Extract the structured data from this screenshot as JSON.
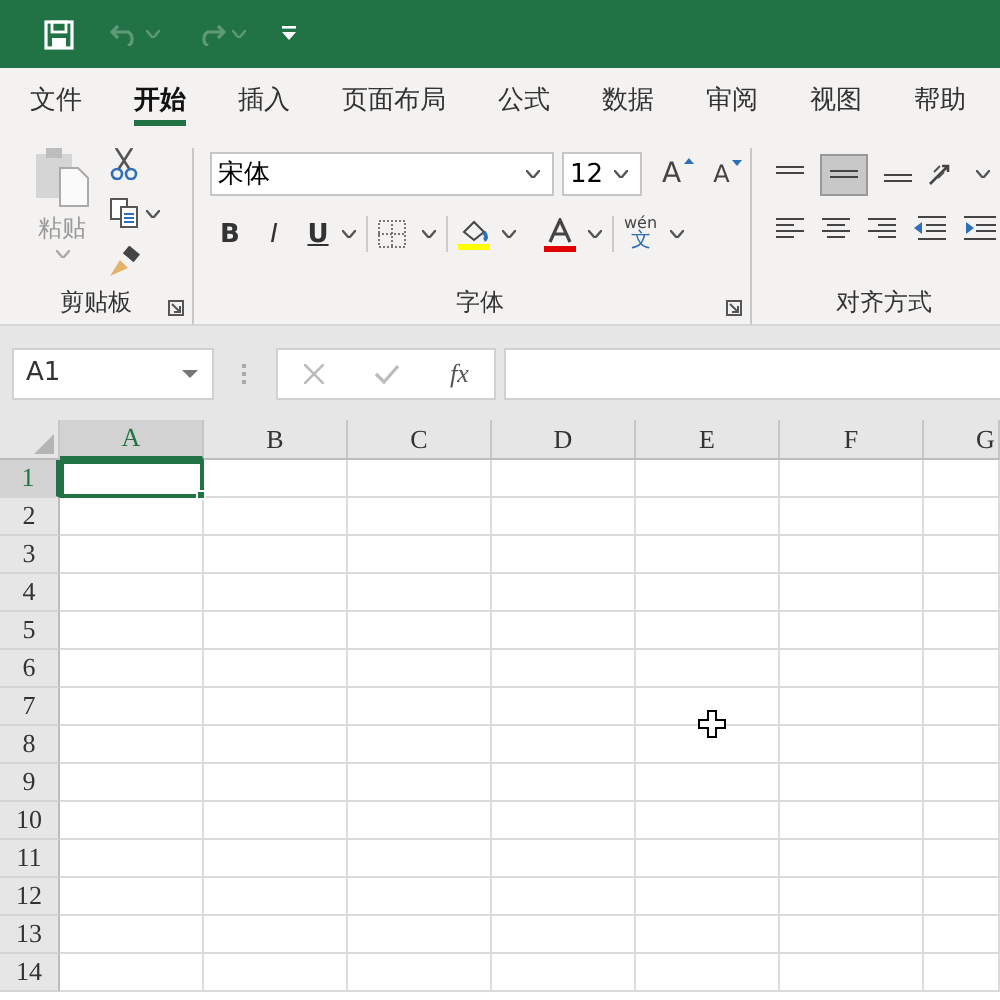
{
  "tabs": [
    {
      "label": "文件",
      "selected": false
    },
    {
      "label": "开始",
      "selected": true
    },
    {
      "label": "插入",
      "selected": false
    },
    {
      "label": "页面布局",
      "selected": false
    },
    {
      "label": "公式",
      "selected": false
    },
    {
      "label": "数据",
      "selected": false
    },
    {
      "label": "审阅",
      "selected": false
    },
    {
      "label": "视图",
      "selected": false
    },
    {
      "label": "帮助",
      "selected": false
    }
  ],
  "ribbon": {
    "clipboard": {
      "label": "剪贴板",
      "paste_label": "粘贴"
    },
    "font": {
      "label": "字体",
      "font_name": "宋体",
      "font_size": "12",
      "grow_glyph": "A",
      "shrink_glyph": "A",
      "format_buttons": [
        {
          "kind": "bold",
          "label": "B"
        },
        {
          "kind": "italic",
          "label": "I"
        },
        {
          "kind": "underline",
          "label": "U"
        }
      ],
      "phonetic": {
        "pinyin": "wén",
        "char": "文"
      }
    },
    "alignment": {
      "label": "对齐方式"
    }
  },
  "formula_bar": {
    "name_box": "A1",
    "fx": "fx"
  },
  "sheet": {
    "columns": [
      {
        "label": "A",
        "selected": true
      },
      {
        "label": "B",
        "selected": false
      },
      {
        "label": "C",
        "selected": false
      },
      {
        "label": "D",
        "selected": false
      },
      {
        "label": "E",
        "selected": false
      },
      {
        "label": "F",
        "selected": false
      },
      {
        "label": "G",
        "selected": false
      }
    ],
    "rows": [
      {
        "label": "1",
        "selected": true
      },
      {
        "label": "2",
        "selected": false
      },
      {
        "label": "3",
        "selected": false
      },
      {
        "label": "4",
        "selected": false
      },
      {
        "label": "5",
        "selected": false
      },
      {
        "label": "6",
        "selected": false
      },
      {
        "label": "7",
        "selected": false
      },
      {
        "label": "8",
        "selected": false
      },
      {
        "label": "9",
        "selected": false
      },
      {
        "label": "10",
        "selected": false
      },
      {
        "label": "11",
        "selected": false
      },
      {
        "label": "12",
        "selected": false
      },
      {
        "label": "13",
        "selected": false
      },
      {
        "label": "14",
        "selected": false
      }
    ]
  }
}
